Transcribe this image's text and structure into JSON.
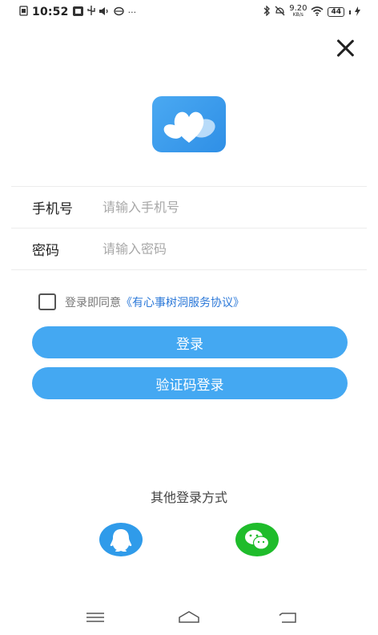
{
  "status_bar": {
    "time": "10:52",
    "left_icons": [
      "file-icon",
      "sim-icon",
      "usb-icon",
      "volume-icon",
      "cloud-icon"
    ],
    "more": "···",
    "net_speed": "9.20",
    "net_speed_unit": "KB/s",
    "battery": "44"
  },
  "app": {
    "brand_color": "#44a8f2",
    "logo_icon": "heart-petals-icon"
  },
  "form": {
    "phone_label": "手机号",
    "phone_placeholder": "请输入手机号",
    "phone_value": "",
    "password_label": "密码",
    "password_placeholder": "请输入密码",
    "password_value": ""
  },
  "agreement": {
    "checked": false,
    "prefix": "登录即同意",
    "link_text": "《有心事树洞服务协议》"
  },
  "buttons": {
    "login": "登录",
    "sms_login": "验证码登录"
  },
  "other_login": {
    "title": "其他登录方式",
    "methods": [
      {
        "name": "qq-icon",
        "color": "#2f9bea"
      },
      {
        "name": "wechat-icon",
        "color": "#1fbc2b"
      }
    ]
  },
  "nav_bar": {
    "icons": [
      "menu-icon",
      "home-icon",
      "back-icon"
    ]
  }
}
